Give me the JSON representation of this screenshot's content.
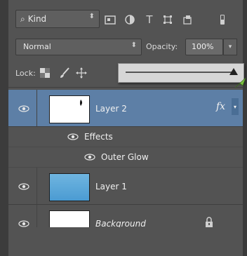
{
  "filter": {
    "kind_label": "Kind",
    "icons": [
      "pixel-filter-icon",
      "adjustment-filter-icon",
      "type-filter-icon",
      "shape-filter-icon",
      "smart-object-filter-icon",
      "filter-toggle-icon"
    ]
  },
  "blend": {
    "mode": "Normal",
    "opacity_label": "Opacity:",
    "opacity_value": "100%"
  },
  "lock": {
    "label": "Lock:",
    "icons": [
      "lock-transparent-icon",
      "lock-image-icon",
      "lock-position-icon"
    ]
  },
  "opacity_slider": {
    "value": 1.0
  },
  "layers": [
    {
      "name": "Layer 2",
      "selected": true,
      "fx": "fx",
      "thumbnail": "white"
    },
    {
      "name": "Layer 1",
      "selected": false,
      "thumbnail": "sky-blue"
    },
    {
      "name": "Background",
      "selected": false,
      "locked": true,
      "thumbnail": "white"
    }
  ],
  "effects": {
    "header": "Effects",
    "items": [
      "Outer Glow"
    ]
  },
  "colors": {
    "panel_bg": "#535353",
    "selected_row": "#5d7fa6",
    "text": "#f0f0f0",
    "cursor": "#7cc242"
  }
}
